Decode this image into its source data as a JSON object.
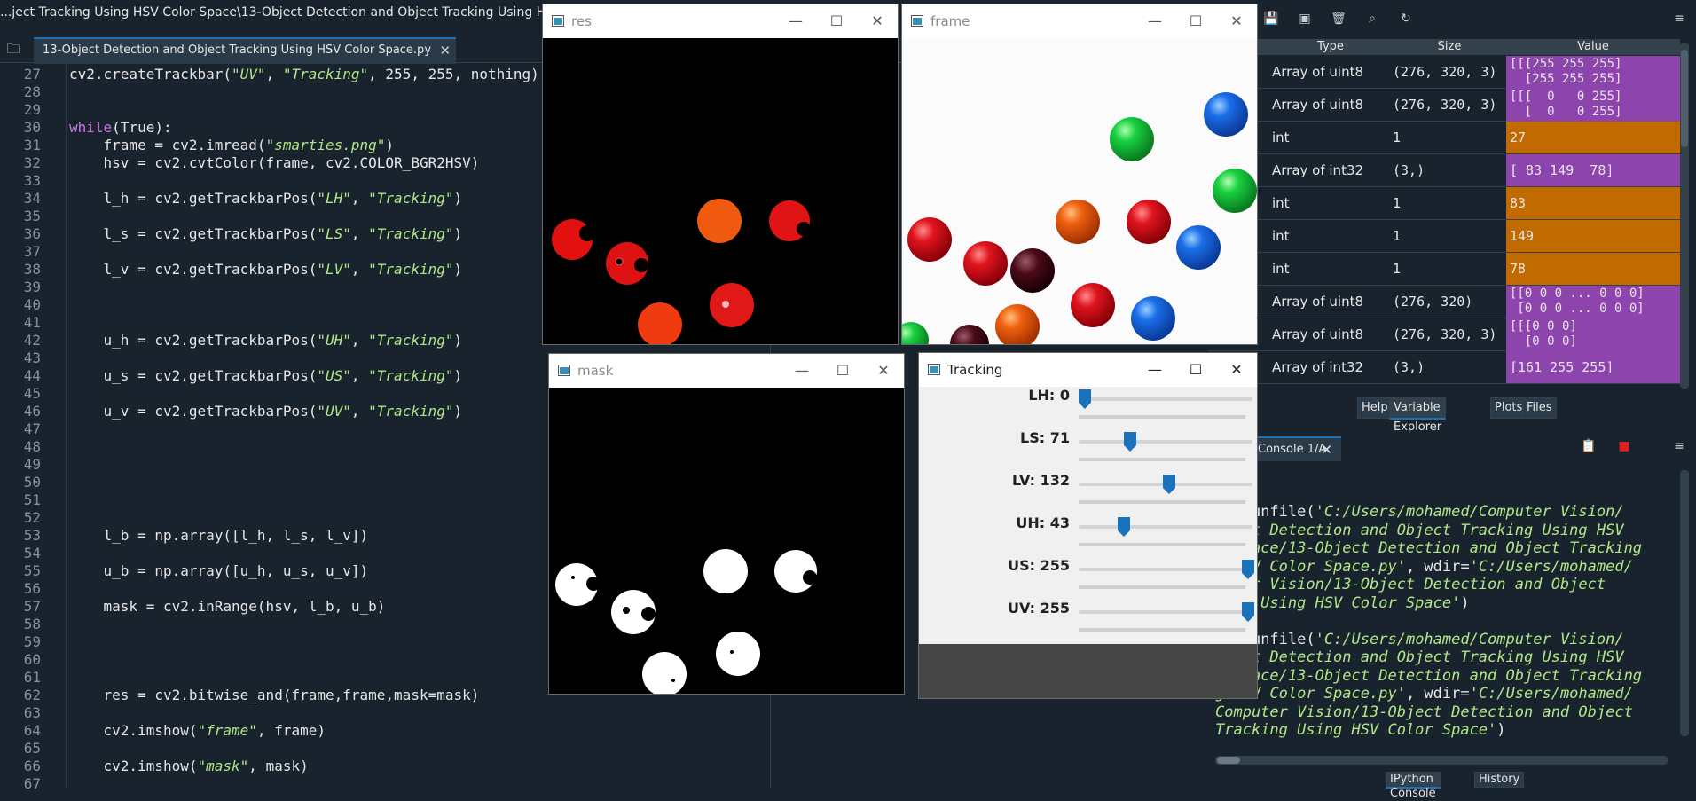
{
  "editor": {
    "title": "...ject Tracking Using HSV Color Space\\13-Object Detection and Object Tracking Using HSV Color Space.py",
    "tab_label": "13-Object Detection and Object Tracking Using HSV Color Space.py",
    "tab_close": "✕",
    "lines": [
      {
        "n": "27",
        "html": "cv2.createTrackbar(<span class='str'>\"UV\"</span>, <span class='str'>\"Tracking\"</span>, 255, 255, nothing)"
      },
      {
        "n": "28",
        "html": ""
      },
      {
        "n": "29",
        "html": ""
      },
      {
        "n": "30",
        "html": "<span class='kw'>while</span>(True):"
      },
      {
        "n": "31",
        "html": "    frame = cv2.imread(<span class='str'>\"smarties.png\"</span>)"
      },
      {
        "n": "32",
        "html": "    hsv = cv2.cvtColor(frame, cv2.COLOR_BGR2HSV)"
      },
      {
        "n": "33",
        "html": ""
      },
      {
        "n": "34",
        "html": "    l_h = cv2.getTrackbarPos(<span class='str'>\"LH\"</span>, <span class='str'>\"Tracking\"</span>)"
      },
      {
        "n": "35",
        "html": ""
      },
      {
        "n": "36",
        "html": "    l_s = cv2.getTrackbarPos(<span class='str'>\"LS\"</span>, <span class='str'>\"Tracking\"</span>)"
      },
      {
        "n": "37",
        "html": ""
      },
      {
        "n": "38",
        "html": "    l_v = cv2.getTrackbarPos(<span class='str'>\"LV\"</span>, <span class='str'>\"Tracking\"</span>)"
      },
      {
        "n": "39",
        "html": ""
      },
      {
        "n": "40",
        "html": ""
      },
      {
        "n": "41",
        "html": ""
      },
      {
        "n": "42",
        "html": "    u_h = cv2.getTrackbarPos(<span class='str'>\"UH\"</span>, <span class='str'>\"Tracking\"</span>)"
      },
      {
        "n": "43",
        "html": ""
      },
      {
        "n": "44",
        "html": "    u_s = cv2.getTrackbarPos(<span class='str'>\"US\"</span>, <span class='str'>\"Tracking\"</span>)"
      },
      {
        "n": "45",
        "html": ""
      },
      {
        "n": "46",
        "html": "    u_v = cv2.getTrackbarPos(<span class='str'>\"UV\"</span>, <span class='str'>\"Tracking\"</span>)"
      },
      {
        "n": "47",
        "html": ""
      },
      {
        "n": "48",
        "html": ""
      },
      {
        "n": "49",
        "html": ""
      },
      {
        "n": "50",
        "html": ""
      },
      {
        "n": "51",
        "html": ""
      },
      {
        "n": "52",
        "html": ""
      },
      {
        "n": "53",
        "html": "    l_b = np.array([l_h, l_s, l_v])"
      },
      {
        "n": "54",
        "html": ""
      },
      {
        "n": "55",
        "html": "    u_b = np.array([u_h, u_s, u_v])"
      },
      {
        "n": "56",
        "html": ""
      },
      {
        "n": "57",
        "html": "    mask = cv2.inRange(hsv, l_b, u_b)"
      },
      {
        "n": "58",
        "html": ""
      },
      {
        "n": "59",
        "html": ""
      },
      {
        "n": "60",
        "html": ""
      },
      {
        "n": "61",
        "html": ""
      },
      {
        "n": "62",
        "html": "    res = cv2.bitwise_and(frame,frame,mask=mask)"
      },
      {
        "n": "63",
        "html": ""
      },
      {
        "n": "64",
        "html": "    cv2.imshow(<span class='str'>\"frame\"</span>, frame)"
      },
      {
        "n": "65",
        "html": ""
      },
      {
        "n": "66",
        "html": "    cv2.imshow(<span class='str'>\"mask\"</span>, mask)"
      },
      {
        "n": "67",
        "html": ""
      }
    ]
  },
  "variable_explorer": {
    "headers": {
      "type": "Type",
      "size": "Size",
      "value": "Value"
    },
    "rows": [
      {
        "type": "Array of uint8",
        "size": "(276, 320, 3)",
        "value": "[[[255 255 255]\n  [255 255 255]",
        "kind": "array"
      },
      {
        "type": "Array of uint8",
        "size": "(276, 320, 3)",
        "value": "[[[  0   0 255]\n  [  0   0 255]",
        "kind": "array"
      },
      {
        "type": "int",
        "size": "1",
        "value": "27",
        "kind": "int"
      },
      {
        "type": "Array of int32",
        "size": "(3,)",
        "value": "[ 83 149  78]",
        "kind": "array"
      },
      {
        "type": "int",
        "size": "1",
        "value": "83",
        "kind": "int"
      },
      {
        "type": "int",
        "size": "1",
        "value": "149",
        "kind": "int"
      },
      {
        "type": "int",
        "size": "1",
        "value": "78",
        "kind": "int"
      },
      {
        "type": "Array of uint8",
        "size": "(276, 320)",
        "value": "[[0 0 0 ... 0 0 0]\n [0 0 0 ... 0 0 0]",
        "kind": "array"
      },
      {
        "type": "Array of uint8",
        "size": "(276, 320, 3)",
        "value": "[[[0 0 0]\n  [0 0 0]",
        "kind": "array"
      },
      {
        "type": "Array of int32",
        "size": "(3,)",
        "value": "[161 255 255]",
        "kind": "array"
      }
    ],
    "colors": {
      "array": "#8e44ad",
      "int": "#c06a00"
    }
  },
  "pane_tabs": [
    "Help",
    "Variable Explorer",
    "Plots",
    "Files"
  ],
  "console": {
    "tab_label": "Console 1/A",
    "lines": [
      {
        "html": "<span class='cg'>]:</span>"
      },
      {
        "html": ""
      },
      {
        "html": "<span class='cg'>]:</span> runfile(<span class='cs'>'C:/Users/mohamed/Computer Vision/</span>"
      },
      {
        "html": "<span class='cs'>bject Detection and Object Tracking Using HSV</span>"
      },
      {
        "html": "<span class='cs'>r Space/13-Object Detection and Object Tracking</span>"
      },
      {
        "html": "<span class='cs'>g HSV Color Space.py'</span>, wdir=<span class='cs'>'C:/Users/mohamed/</span>"
      },
      {
        "html": "<span class='cs'>puter Vision/13-Object Detection and Object</span>"
      },
      {
        "html": "<span class='cs'>king Using HSV Color Space'</span>)"
      },
      {
        "html": ""
      },
      {
        "html": "<span class='cg'>]:</span> runfile(<span class='cs'>'C:/Users/mohamed/Computer Vision/</span>"
      },
      {
        "html": "<span class='cs'>bject Detection and Object Tracking Using HSV</span>"
      },
      {
        "html": "<span class='cs'>r Space/13-Object Detection and Object Tracking</span>"
      },
      {
        "html": "<span class='cs'>g HSV Color Space.py'</span>, wdir=<span class='cs'>'C:/Users/mohamed/</span>"
      },
      {
        "html": "<span class='cs'>Computer Vision/13-Object Detection and Object</span>"
      },
      {
        "html": "<span class='cs'>Tracking Using HSV Color Space'</span>)"
      }
    ]
  },
  "bottom_tabs": [
    "IPython Console",
    "History"
  ],
  "windows": {
    "res": {
      "title": "res"
    },
    "frame": {
      "title": "frame"
    },
    "mask": {
      "title": "mask"
    },
    "tracking": {
      "title": "Tracking"
    }
  },
  "window_buttons": {
    "minimize": "—",
    "maximize": "☐",
    "close": "✕"
  },
  "trackbars": [
    {
      "label": "LH: 0",
      "value": 0,
      "max": 179
    },
    {
      "label": "LS: 71",
      "value": 71,
      "max": 255
    },
    {
      "label": "LV: 132",
      "value": 132,
      "max": 255
    },
    {
      "label": "UH: 43",
      "value": 43,
      "max": 179
    },
    {
      "label": "US: 255",
      "value": 255,
      "max": 255
    },
    {
      "label": "UV: 255",
      "value": 255,
      "max": 255
    }
  ],
  "accent": "#1a72bb"
}
